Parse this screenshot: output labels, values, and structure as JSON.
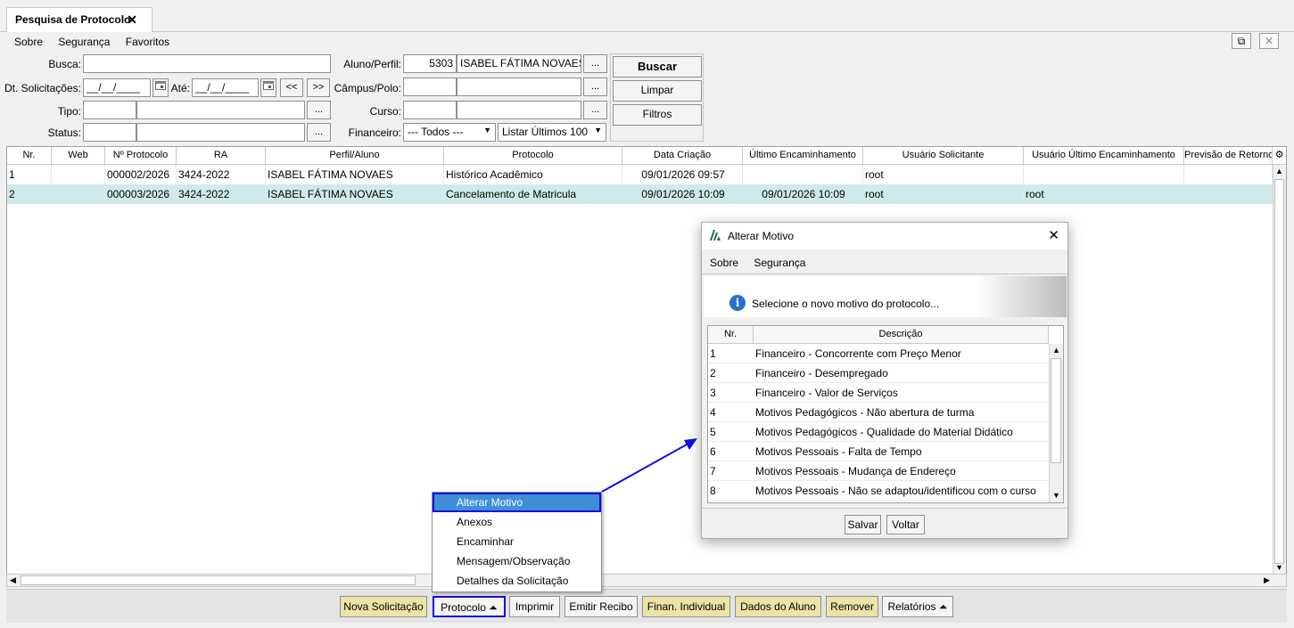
{
  "tab": {
    "title": "Pesquisa de Protocolo",
    "close": "✕"
  },
  "menu": {
    "sobre": "Sobre",
    "seguranca": "Segurança",
    "favoritos": "Favoritos"
  },
  "window_buttons": {
    "popout": "⧉",
    "close": "✕"
  },
  "form": {
    "busca_label": "Busca:",
    "busca_value": "",
    "dt_label": "Dt. Solicitações:",
    "dt_from": "__/__/____",
    "ate_label": "Até:",
    "dt_to": "__/__/____",
    "prev_label": "<<",
    "next_label": ">>",
    "tipo_label": "Tipo:",
    "status_label": "Status:",
    "aluno_label": "Aluno/Perfil:",
    "aluno_code": "5303",
    "aluno_name": "ISABEL FÁTIMA NOVAES",
    "campus_label": "Câmpus/Polo:",
    "curso_label": "Curso:",
    "financeiro_label": "Financeiro:",
    "financeiro_value": "--- Todos ---",
    "listar_value": "Listar Últimos 100",
    "ellipsis": "...",
    "buscar": "Buscar",
    "limpar": "Limpar",
    "filtros": "Filtros"
  },
  "grid": {
    "columns": [
      "Nr.",
      "Web",
      "Nº Protocolo",
      "RA",
      "Perfil/Aluno",
      "Protocolo",
      "Data Criação",
      "Último Encaminhamento",
      "Usuário Solicitante",
      "Usuário Último Encaminhamento",
      "Previsão de Retorno"
    ],
    "rows": [
      {
        "nr": "1",
        "web": "",
        "protocolo_n": "000002/2026",
        "ra": "3424-2022",
        "aluno": "ISABEL FÁTIMA NOVAES",
        "protocolo": "Histórico Acadêmico",
        "criacao": "09/01/2026 09:57",
        "ultimo": "",
        "solicitante": "root",
        "usuario_ultimo": "",
        "previsao": ""
      },
      {
        "nr": "2",
        "web": "",
        "protocolo_n": "000003/2026",
        "ra": "3424-2022",
        "aluno": "ISABEL FÁTIMA NOVAES",
        "protocolo": "Cancelamento de Matricula",
        "criacao": "09/01/2026 10:09",
        "ultimo": "09/01/2026 10:09",
        "solicitante": "root",
        "usuario_ultimo": "root",
        "previsao": ""
      }
    ]
  },
  "popup_menu": [
    "Alterar Motivo",
    "Anexos",
    "Encaminhar",
    "Mensagem/Observação",
    "Detalhes da Solicitação"
  ],
  "toolbar": {
    "nova": "Nova Solicitação",
    "protocolo": "Protocolo ⏶",
    "imprimir": "Imprimir",
    "emitir": "Emitir Recibo",
    "finan": "Finan. Individual",
    "dados": "Dados do Aluno",
    "remover": "Remover",
    "relatorios": "Relatórios ⏶"
  },
  "dialog": {
    "title": "Alterar Motivo",
    "close": "✕",
    "menu_sobre": "Sobre",
    "menu_seguranca": "Segurança",
    "info": "Selecione o novo motivo do protocolo...",
    "col_nr": "Nr.",
    "col_desc": "Descrição",
    "rows": [
      {
        "nr": "1",
        "desc": "Financeiro - Concorrente com Preço Menor"
      },
      {
        "nr": "2",
        "desc": "Financeiro - Desempregado"
      },
      {
        "nr": "3",
        "desc": "Financeiro - Valor de Serviços"
      },
      {
        "nr": "4",
        "desc": "Motivos Pedagógicos - Não abertura de turma"
      },
      {
        "nr": "5",
        "desc": "Motivos Pedagógicos - Qualidade do Material Didático"
      },
      {
        "nr": "6",
        "desc": "Motivos Pessoais - Falta de Tempo"
      },
      {
        "nr": "7",
        "desc": "Motivos Pessoais - Mudança de Endereço"
      },
      {
        "nr": "8",
        "desc": "Motivos Pessoais - Não se adaptou/identificou com o curso"
      }
    ],
    "salvar": "Salvar",
    "voltar": "Voltar"
  },
  "colors": {
    "selected_row": "#cfeaea",
    "highlight": "#3e8fd8",
    "annotation": "#1010e0",
    "yellow_button": "#ece3a6"
  },
  "icons": [
    "close-icon",
    "popout-icon",
    "calendar-icon",
    "info-icon",
    "app-logo-icon",
    "chevron-up-icon",
    "chevron-down-icon",
    "settings-icon"
  ]
}
